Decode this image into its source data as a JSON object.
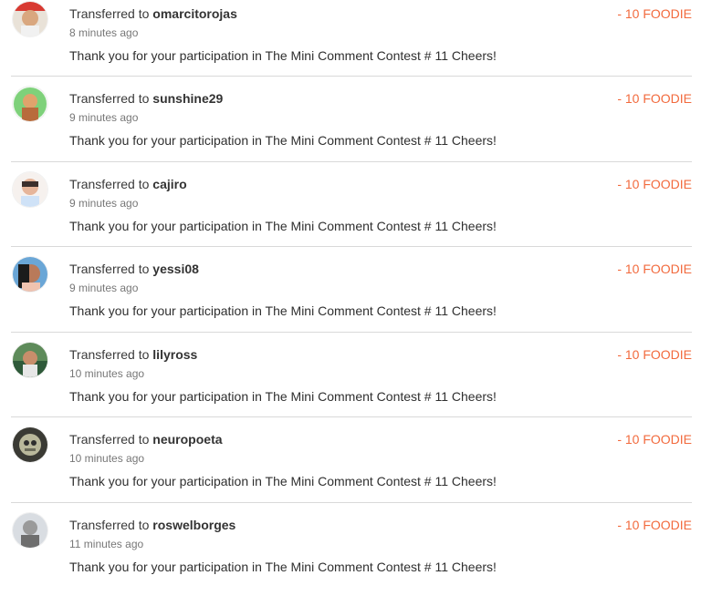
{
  "transactions": [
    {
      "prefix": "Transferred to",
      "user": "omarcitorojas",
      "time": "8 minutes ago",
      "memo": "Thank you for your participation in The Mini Comment Contest # 11 Cheers!",
      "amount": "- 10 FOODIE"
    },
    {
      "prefix": "Transferred to",
      "user": "sunshine29",
      "time": "9 minutes ago",
      "memo": "Thank you for your participation in The Mini Comment Contest # 11 Cheers!",
      "amount": "- 10 FOODIE"
    },
    {
      "prefix": "Transferred to",
      "user": "cajiro",
      "time": "9 minutes ago",
      "memo": "Thank you for your participation in The Mini Comment Contest # 11 Cheers!",
      "amount": "- 10 FOODIE"
    },
    {
      "prefix": "Transferred to",
      "user": "yessi08",
      "time": "9 minutes ago",
      "memo": "Thank you for your participation in The Mini Comment Contest # 11 Cheers!",
      "amount": "- 10 FOODIE"
    },
    {
      "prefix": "Transferred to",
      "user": "lilyross",
      "time": "10 minutes ago",
      "memo": "Thank you for your participation in The Mini Comment Contest # 11 Cheers!",
      "amount": "- 10 FOODIE"
    },
    {
      "prefix": "Transferred to",
      "user": "neuropoeta",
      "time": "10 minutes ago",
      "memo": "Thank you for your participation in The Mini Comment Contest # 11 Cheers!",
      "amount": "- 10 FOODIE"
    },
    {
      "prefix": "Transferred to",
      "user": "roswelborges",
      "time": "11 minutes ago",
      "memo": "Thank you for your participation in The Mini Comment Contest # 11 Cheers!",
      "amount": "- 10 FOODIE"
    }
  ],
  "colors": {
    "amount": "#f26a3d",
    "divider": "#d9d9d9",
    "text": "#333333",
    "muted": "#777777"
  }
}
